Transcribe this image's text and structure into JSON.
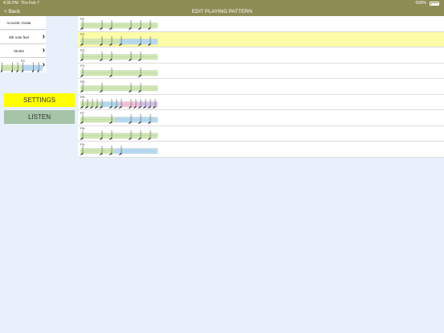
{
  "status": {
    "time": "4:35 PM",
    "date": "Thu Feb 7",
    "battery": "100%",
    "wifi_icon": "wifi-icon"
  },
  "nav": {
    "back_label": "< Back",
    "title": "EDIT PLAYING PATTERN"
  },
  "sidebar": {
    "items": [
      {
        "label": "Acoustic Guitar",
        "has_chevron": false
      },
      {
        "label": "8th note feel",
        "has_chevron": true
      },
      {
        "label": "Stroke",
        "has_chevron": true
      }
    ],
    "current_pattern": "P2"
  },
  "buttons": {
    "settings": "SETTINGS",
    "listen": "LISTEN"
  },
  "colors": {
    "bar": "#8d8c55",
    "green": "#cfe8b0",
    "blue": "#b6daf2",
    "pink": "#f3c3d8",
    "purple": "#d6c4ec",
    "selected": "#fdfca8",
    "yellow": "#ffff00",
    "listen": "#a6c4a8"
  },
  "patterns": [
    {
      "label": "P1",
      "selected": false,
      "segments": [
        [
          "green",
          16
        ]
      ],
      "notes": [
        1,
        5,
        7,
        11,
        13,
        15
      ]
    },
    {
      "label": "P2",
      "selected": true,
      "segments": [
        [
          "green",
          8
        ],
        [
          "blue",
          8
        ]
      ],
      "notes": [
        1,
        5,
        7,
        9,
        13,
        15
      ]
    },
    {
      "label": "P3",
      "selected": false,
      "segments": [
        [
          "green",
          16
        ]
      ],
      "notes": [
        1,
        5,
        7,
        11,
        13
      ]
    },
    {
      "label": "P4",
      "selected": false,
      "segments": [
        [
          "green",
          16
        ]
      ],
      "notes": [
        1,
        7,
        13
      ]
    },
    {
      "label": "P5",
      "selected": false,
      "segments": [
        [
          "green",
          16
        ]
      ],
      "notes": [
        1,
        5,
        11,
        13
      ]
    },
    {
      "label": "P6",
      "selected": false,
      "segments": [
        [
          "green",
          4
        ],
        [
          "blue",
          4
        ],
        [
          "pink",
          4
        ],
        [
          "purple",
          4
        ]
      ],
      "notes": [
        1,
        2,
        3,
        4,
        5,
        7,
        8,
        9,
        11,
        12,
        13,
        14,
        15,
        16
      ]
    },
    {
      "label": "P7",
      "selected": false,
      "segments": [
        [
          "green",
          7
        ],
        [
          "blue",
          9
        ]
      ],
      "notes": [
        1,
        7,
        11,
        13,
        15
      ]
    },
    {
      "label": "P8",
      "selected": false,
      "segments": [
        [
          "green",
          16
        ]
      ],
      "notes": [
        1,
        5,
        7,
        11,
        13,
        15
      ]
    },
    {
      "label": "P9",
      "selected": false,
      "segments": [
        [
          "green",
          7
        ],
        [
          "blue",
          9
        ]
      ],
      "notes": [
        1,
        5,
        7,
        9
      ]
    }
  ]
}
